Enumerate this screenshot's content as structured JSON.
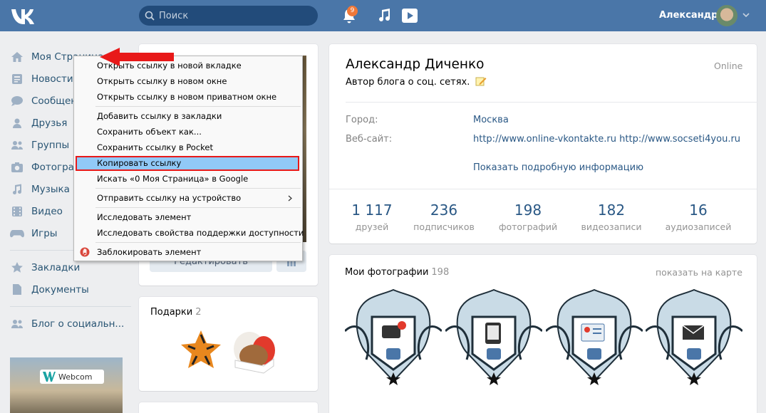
{
  "topbar": {
    "search_placeholder": "Поиск",
    "notification_count": "9",
    "username": "Александр"
  },
  "nav": {
    "items": [
      {
        "label": "Моя Страница",
        "icon": "home-icon"
      },
      {
        "label": "Новости",
        "icon": "news-icon"
      },
      {
        "label": "Сообщения",
        "icon": "messages-icon"
      },
      {
        "label": "Друзья",
        "icon": "friends-icon"
      },
      {
        "label": "Группы",
        "icon": "groups-icon"
      },
      {
        "label": "Фотографии",
        "icon": "photos-icon"
      },
      {
        "label": "Музыка",
        "icon": "music-icon"
      },
      {
        "label": "Видео",
        "icon": "video-icon"
      },
      {
        "label": "Игры",
        "icon": "games-icon"
      }
    ],
    "secondary": [
      {
        "label": "Закладки",
        "icon": "star-icon"
      },
      {
        "label": "Документы",
        "icon": "document-icon"
      }
    ],
    "tertiary": [
      {
        "label": "Блог о социальн...",
        "icon": "group-icon"
      }
    ],
    "promo_label": "Webcom"
  },
  "profile": {
    "edit_label": "Редактировать",
    "gifts_label": "Подарки",
    "gifts_count": "2",
    "name": "Александр Диченко",
    "status": "Автор блога о соц. сетях.",
    "online": "Online",
    "city_label": "Город:",
    "city_value": "Москва",
    "website_label": "Веб-сайт:",
    "website_value": "http://www.online-vkontakte.ru http://www.socseti4you.ru",
    "more_info": "Показать подробную информацию",
    "counters": [
      {
        "num": "1 117",
        "label": "друзей"
      },
      {
        "num": "236",
        "label": "подписчиков"
      },
      {
        "num": "198",
        "label": "фотографий"
      },
      {
        "num": "182",
        "label": "видеозаписи"
      },
      {
        "num": "16",
        "label": "аудиозаписей"
      }
    ],
    "photos_title": "Мои фотографии",
    "photos_count": "198",
    "photos_map_link": "показать на карте"
  },
  "context_menu": {
    "items": [
      "Открыть ссылку в новой вкладке",
      "Открыть ссылку в новом окне",
      "Открыть ссылку в новом приватном окне",
      "Добавить ссылку в закладки",
      "Сохранить объект как...",
      "Сохранить ссылку в Pocket",
      "Копировать ссылку",
      "Искать «0 Моя Страница» в Google",
      "Отправить ссылку на устройство",
      "Исследовать элемент",
      "Исследовать свойства поддержки доступности",
      "Заблокировать элемент"
    ],
    "highlighted_index": 6
  },
  "colors": {
    "header": "#4a76a8",
    "link": "#2a5885",
    "arrow": "#e81919",
    "highlight": "#91c9f7"
  }
}
